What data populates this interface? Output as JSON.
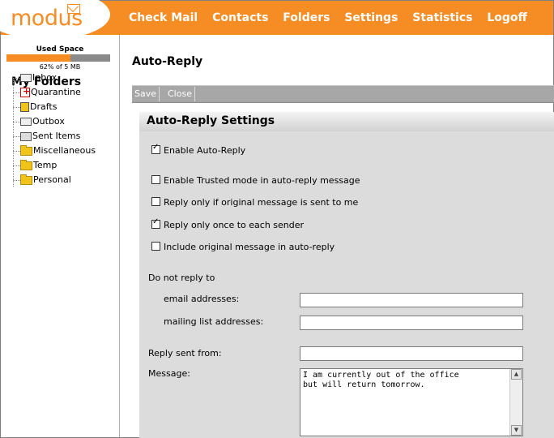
{
  "logo": {
    "text": "modus"
  },
  "nav": [
    "Check Mail",
    "Contacts",
    "Folders",
    "Settings",
    "Statistics",
    "Logoff"
  ],
  "sidebar": {
    "used_space_label": "Used Space",
    "used_space_text": "62% of 5 MB",
    "used_fraction": 0.62,
    "heading": "My Folders",
    "folders": [
      {
        "label": "Inbox",
        "icon": "inbox-icon"
      },
      {
        "label": "Quarantine",
        "icon": "quarantine-icon"
      },
      {
        "label": "Drafts",
        "icon": "drafts-icon"
      },
      {
        "label": "Outbox",
        "icon": "outbox-icon"
      },
      {
        "label": "Sent Items",
        "icon": "sent-items-icon"
      },
      {
        "label": "Miscellaneous",
        "icon": "folder-icon"
      },
      {
        "label": "Temp",
        "icon": "folder-icon"
      },
      {
        "label": "Personal",
        "icon": "folder-icon"
      }
    ]
  },
  "page": {
    "title": "Auto-Reply"
  },
  "toolbar": {
    "save_label": "Save",
    "close_label": "Close"
  },
  "settings": {
    "heading": "Auto-Reply Settings",
    "enable_auto_reply": {
      "label": "Enable Auto-Reply",
      "checked": true
    },
    "options": [
      {
        "label": "Enable Trusted mode in auto-reply message",
        "checked": false
      },
      {
        "label": "Reply only if original message is sent to me",
        "checked": false
      },
      {
        "label": "Reply only once to each sender",
        "checked": true
      },
      {
        "label": "Include original message in auto-reply",
        "checked": false
      }
    ],
    "do_not_reply_label": "Do not reply to",
    "email_addresses_label": "email addresses:",
    "email_addresses_value": "",
    "mailing_list_label": "mailing list addresses:",
    "mailing_list_value": "",
    "reply_from_label": "Reply sent from:",
    "reply_from_value": "",
    "message_label": "Message:",
    "message_value": "I am currently out of the office\nbut will return tomorrow."
  },
  "colors": {
    "brand": "#f68c24",
    "toolbar": "#a7a7a7",
    "panel": "#dcdcdc"
  }
}
